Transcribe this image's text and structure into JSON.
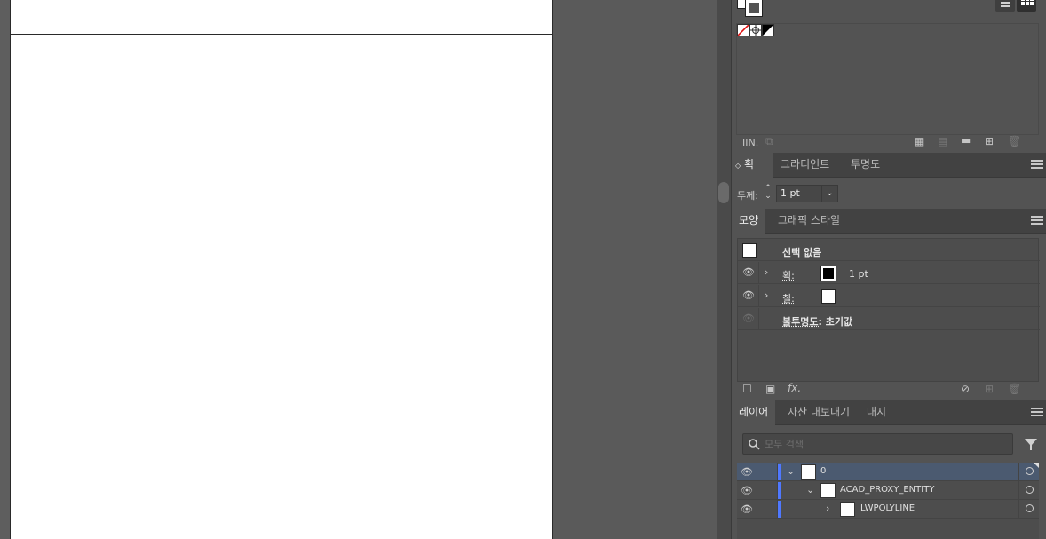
{
  "swatches": {
    "view_list_icon": "list-view-icon",
    "view_grid_icon": "grid-view-icon",
    "chips": [
      "none-swatch",
      "registration-swatch",
      "black-white-swatch"
    ],
    "bottom_icons_left": [
      "IIN.",
      "+"
    ],
    "bottom_icons_right": [
      "grid-menu-icon",
      "swatch-options-icon",
      "new-color-group-icon",
      "new-swatch-icon",
      "delete-icon"
    ]
  },
  "stroke_panel": {
    "tabs": [
      "획",
      "그라디언트",
      "투명도"
    ],
    "tab_prefix": "◇",
    "weight_label": "두께:",
    "weight_value": "1 pt"
  },
  "appearance_panel": {
    "tabs": [
      "모양",
      "그래픽 스타일"
    ],
    "selection_label": "선택 없음",
    "rows": [
      {
        "name": "획:",
        "value": "1 pt"
      },
      {
        "name": "칠:",
        "value": ""
      },
      {
        "name": "불투명도:",
        "value": "초기값"
      }
    ]
  },
  "layers_panel": {
    "tabs": [
      "레이어",
      "자산 내보내기",
      "대지"
    ],
    "search_placeholder": "모두 검색",
    "layers": [
      {
        "name": "0",
        "expanded": true,
        "selected": true
      },
      {
        "name": "ACAD_PROXY_ENTITY",
        "expanded": true,
        "selected": false
      },
      {
        "name": "LWPOLYLINE",
        "expanded": false,
        "selected": false
      }
    ]
  },
  "colors": {
    "panel_bg": "#535353",
    "tab_bar": "#424242",
    "selected_row": "#4b5a70",
    "layer_color": "#4f78ff"
  }
}
